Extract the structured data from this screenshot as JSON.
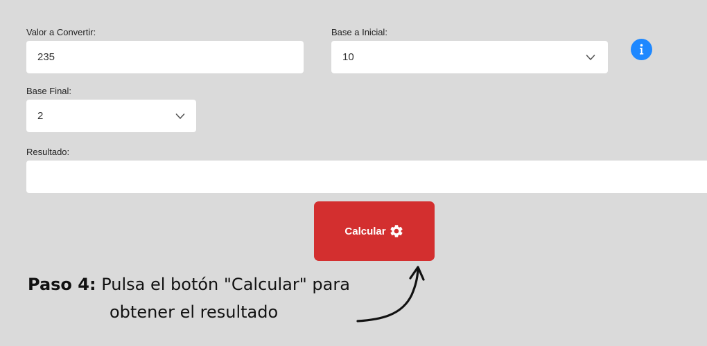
{
  "form": {
    "valor_label": "Valor a Convertir:",
    "valor_value": "235",
    "base_inicial_label": "Base a Inicial:",
    "base_inicial_value": "10",
    "base_final_label": "Base Final:",
    "base_final_value": "2",
    "resultado_label": "Resultado:",
    "resultado_value": ""
  },
  "button": {
    "label": "Calcular",
    "icon": "gear-icon"
  },
  "info": {
    "icon": "info-icon",
    "glyph": "i"
  },
  "caption": {
    "step": "Paso 4:",
    "line1_rest": " Pulsa el botón \"Calcular\" para",
    "line2": "obtener el resultado"
  },
  "colors": {
    "background": "#dadada",
    "button": "#d32f2f",
    "info": "#1e88ff"
  }
}
